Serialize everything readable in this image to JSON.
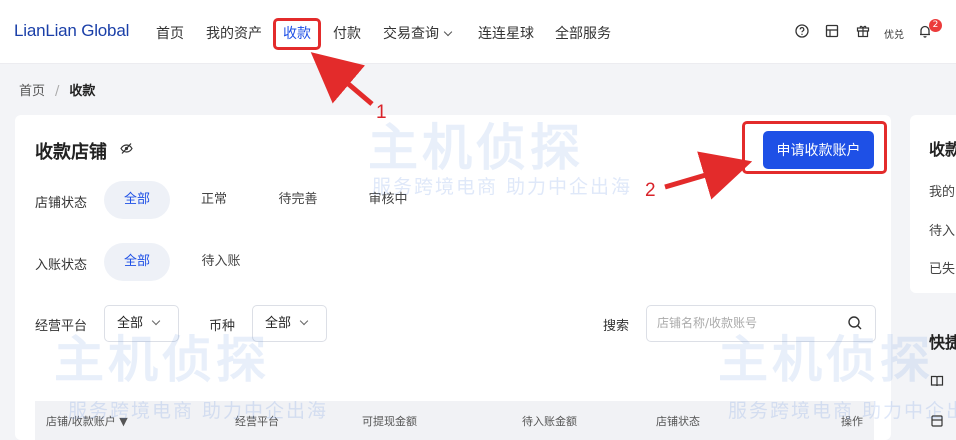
{
  "brand": "LianLian Global",
  "nav": {
    "items": [
      "首页",
      "我的资产",
      "收款",
      "付款",
      "交易查询",
      "连连星球",
      "全部服务"
    ],
    "active": "收款",
    "right": {
      "youhui_label": "优兑",
      "notification_count": "2"
    }
  },
  "breadcrumb": {
    "home": "首页",
    "current": "收款"
  },
  "card": {
    "title": "收款店铺",
    "apply_button": "申请收款账户",
    "filters": {
      "store_status": {
        "label": "店铺状态",
        "options": [
          "全部",
          "正常",
          "待完善",
          "审核中"
        ],
        "selected": "全部"
      },
      "entry_status": {
        "label": "入账状态",
        "options": [
          "全部",
          "待入账"
        ],
        "selected": "全部"
      },
      "platform": {
        "label": "经营平台",
        "value": "全部"
      },
      "currency": {
        "label": "币种",
        "value": "全部"
      },
      "search": {
        "label": "搜索",
        "placeholder": "店铺名称/收款账号"
      }
    },
    "table_headers": [
      "店铺/收款账户",
      "经营平台",
      "可提现金额",
      "待入账金额",
      "店铺状态",
      "操作"
    ]
  },
  "side": {
    "title": "收款",
    "items": [
      "我的",
      "待入",
      "已失"
    ],
    "quick_title": "快捷"
  },
  "watermark": {
    "main": "主机侦探",
    "sub": "服务跨境电商 助力中企出海"
  },
  "annotations": {
    "step1": "1",
    "step2": "2",
    "color": "#e32b2b"
  },
  "colors": {
    "primary": "#1e50e6",
    "brand": "#1a3fa8",
    "badge": "#ec3b3b"
  }
}
